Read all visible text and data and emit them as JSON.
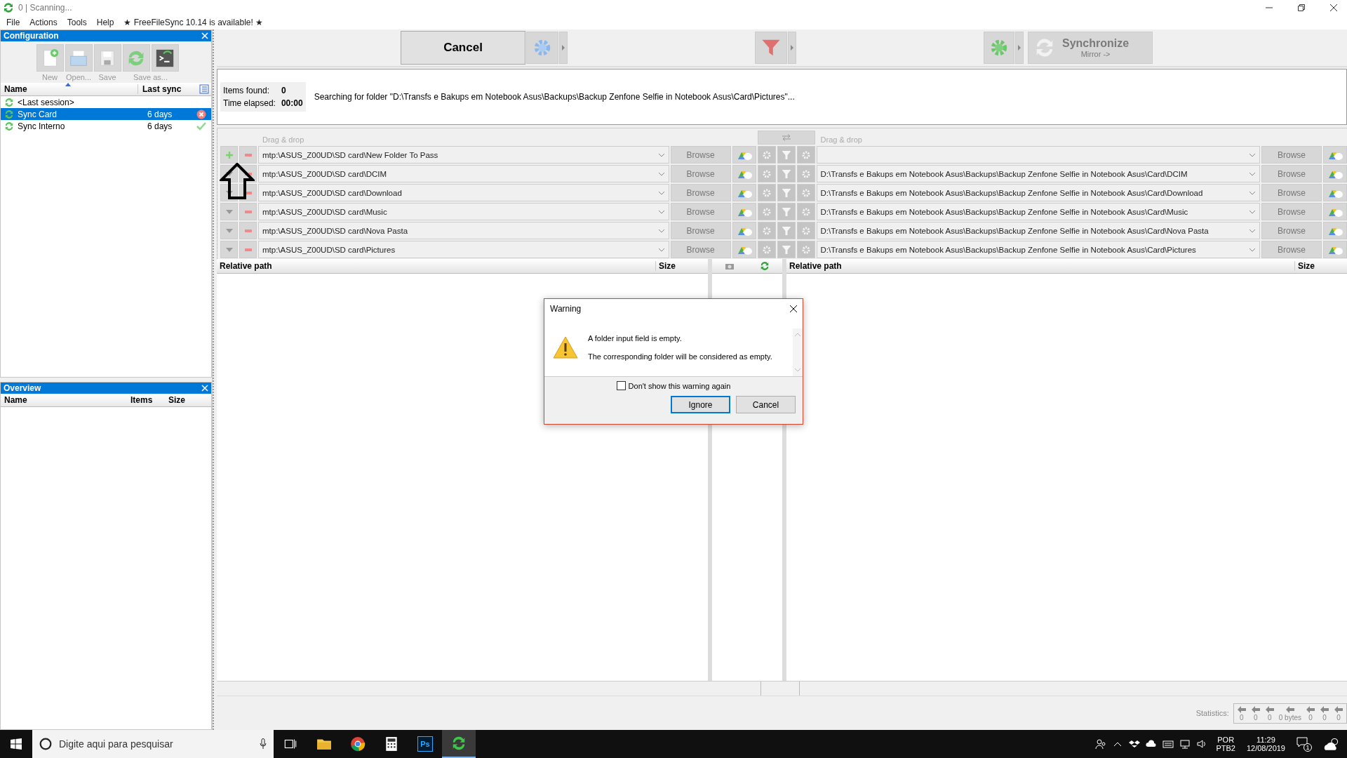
{
  "window": {
    "title": "0 | Scanning..."
  },
  "menu": [
    "File",
    "Actions",
    "Tools",
    "Help"
  ],
  "update_notice": "★ FreeFileSync 10.14 is available! ★",
  "config_panel": {
    "title": "Configuration",
    "tools": [
      {
        "kind": "new",
        "label": "New"
      },
      {
        "kind": "open",
        "label": "Open..."
      },
      {
        "kind": "save",
        "label": "Save"
      },
      {
        "kind": "saveas",
        "label": "Save as..."
      },
      {
        "kind": "batch"
      }
    ],
    "columns": [
      "Name",
      "Last sync"
    ],
    "items": [
      {
        "kind": "plain",
        "name": "<Last session>",
        "selected": false
      },
      {
        "kind": "error",
        "name": "Sync Card",
        "last_sync": "6 days",
        "selected": true
      },
      {
        "kind": "ok",
        "name": "Sync Interno",
        "last_sync": "6 days",
        "selected": false
      }
    ]
  },
  "overview_panel": {
    "title": "Overview",
    "columns": [
      "Name",
      "Items",
      "Size"
    ]
  },
  "toolbar": {
    "cancel": "Cancel",
    "sync_label": "Synchronize",
    "sync_variant": "Mirror ->"
  },
  "status": {
    "items_label": "Items found:",
    "items_value": "0",
    "time_label": "Time elapsed:",
    "time_value": "00:00",
    "message": "Searching for folder \"D:\\Transfs e Bakups em Notebook Asus\\Backups\\Backup Zenfone Selfie in Notebook Asus\\Card\\Pictures\"..."
  },
  "folders": {
    "left_header": "Drag & drop",
    "right_header": "Drag & drop",
    "pairs": [
      {
        "kind": "main",
        "left": "mtp:\\ASUS_Z00UD\\SD card\\New Folder To Pass",
        "left_browse": "Browse",
        "right_browse": "Browse"
      },
      {
        "kind": "extra",
        "left": "mtp:\\ASUS_Z00UD\\SD card\\DCIM",
        "right": "D:\\Transfs e Bakups em Notebook Asus\\Backups\\Backup Zenfone Selfie in Notebook Asus\\Card\\DCIM",
        "left_browse": "Browse",
        "right_browse": "Browse"
      },
      {
        "kind": "extra",
        "left": "mtp:\\ASUS_Z00UD\\SD card\\Download",
        "right": "D:\\Transfs e Bakups em Notebook Asus\\Backups\\Backup Zenfone Selfie in Notebook Asus\\Card\\Download",
        "left_browse": "Browse",
        "right_browse": "Browse"
      },
      {
        "kind": "extra",
        "left": "mtp:\\ASUS_Z00UD\\SD card\\Music",
        "right": "D:\\Transfs e Bakups em Notebook Asus\\Backups\\Backup Zenfone Selfie in Notebook Asus\\Card\\Music",
        "left_browse": "Browse",
        "right_browse": "Browse"
      },
      {
        "kind": "extra",
        "left": "mtp:\\ASUS_Z00UD\\SD card\\Nova Pasta",
        "right": "D:\\Transfs e Bakups em Notebook Asus\\Backups\\Backup Zenfone Selfie in Notebook Asus\\Card\\Nova Pasta",
        "left_browse": "Browse",
        "right_browse": "Browse"
      },
      {
        "kind": "extra",
        "left": "mtp:\\ASUS_Z00UD\\SD card\\Pictures",
        "right": "D:\\Transfs e Bakups em Notebook Asus\\Backups\\Backup Zenfone Selfie in Notebook Asus\\Card\\Pictures",
        "left_browse": "Browse",
        "right_browse": "Browse"
      }
    ]
  },
  "grid": {
    "left_columns": [
      "Relative path",
      "Size"
    ],
    "right_columns": [
      "Relative path",
      "Size"
    ]
  },
  "statistics": {
    "label": "Statistics:",
    "values": [
      "0",
      "0",
      "0",
      "0 bytes",
      "0",
      "0",
      "0"
    ]
  },
  "dialog": {
    "title": "Warning",
    "lines": [
      "A folder input field is empty.",
      "The corresponding folder will be considered as empty."
    ],
    "checkbox": {
      "label": "Don't show this warning again",
      "checked": false
    },
    "buttons": [
      {
        "label": "Ignore",
        "focused": true
      },
      {
        "label": "Cancel",
        "focused": false
      }
    ]
  },
  "taskbar": {
    "search_placeholder": "Digite aqui para pesquisar",
    "apps": [
      {
        "kind": "taskview",
        "selected": false
      },
      {
        "kind": "explorer",
        "selected": false
      },
      {
        "kind": "chrome",
        "selected": false
      },
      {
        "kind": "calculator",
        "selected": false
      },
      {
        "kind": "photoshop",
        "label": "Ps",
        "selected": false
      },
      {
        "kind": "sync",
        "selected": true
      }
    ],
    "language": "POR",
    "layout": "PTB2",
    "time": "11:29",
    "date": "12/08/2019",
    "notifications": "1"
  }
}
